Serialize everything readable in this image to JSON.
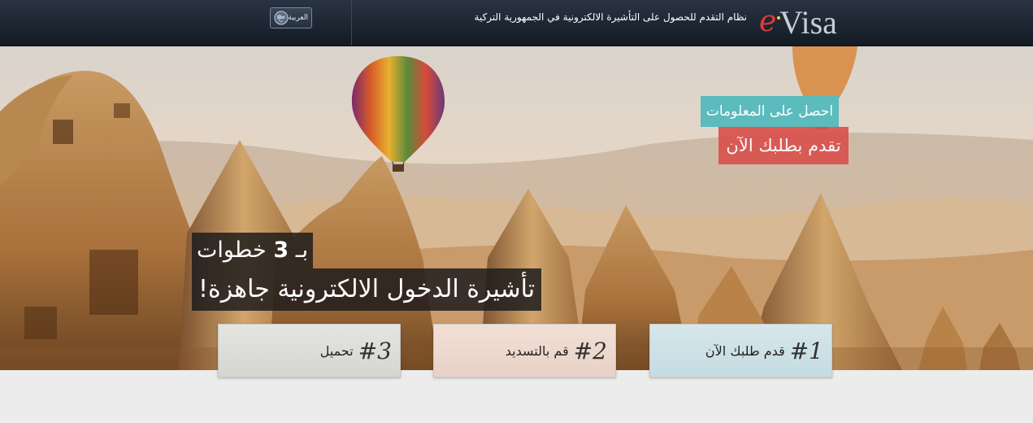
{
  "header": {
    "logo_e": "e",
    "logo_visa": "Visa",
    "tagline": "نظام التقدم للحصول على التأشيرة الالكترونية في الجمهورية التركية",
    "language_label": "العربية"
  },
  "hero": {
    "info_button": "احصل على المعلومات",
    "apply_button": "تقدم بطلبك الآن",
    "headline_line1_prefix": "بـ",
    "headline_line1_number": "3",
    "headline_line1_suffix": "خطوات",
    "headline_line2": "تأشيرة الدخول الالكترونية جاهزة!"
  },
  "steps": [
    {
      "number": "#1",
      "label": "قدم طلبك الآن"
    },
    {
      "number": "#2",
      "label": "قم بالتسديد"
    },
    {
      "number": "#3",
      "label": "تحميل"
    }
  ],
  "colors": {
    "info": "#5bbbbd",
    "apply": "#d9534f",
    "header_bg": "#1a2330",
    "logo_red": "#e03a3a"
  }
}
